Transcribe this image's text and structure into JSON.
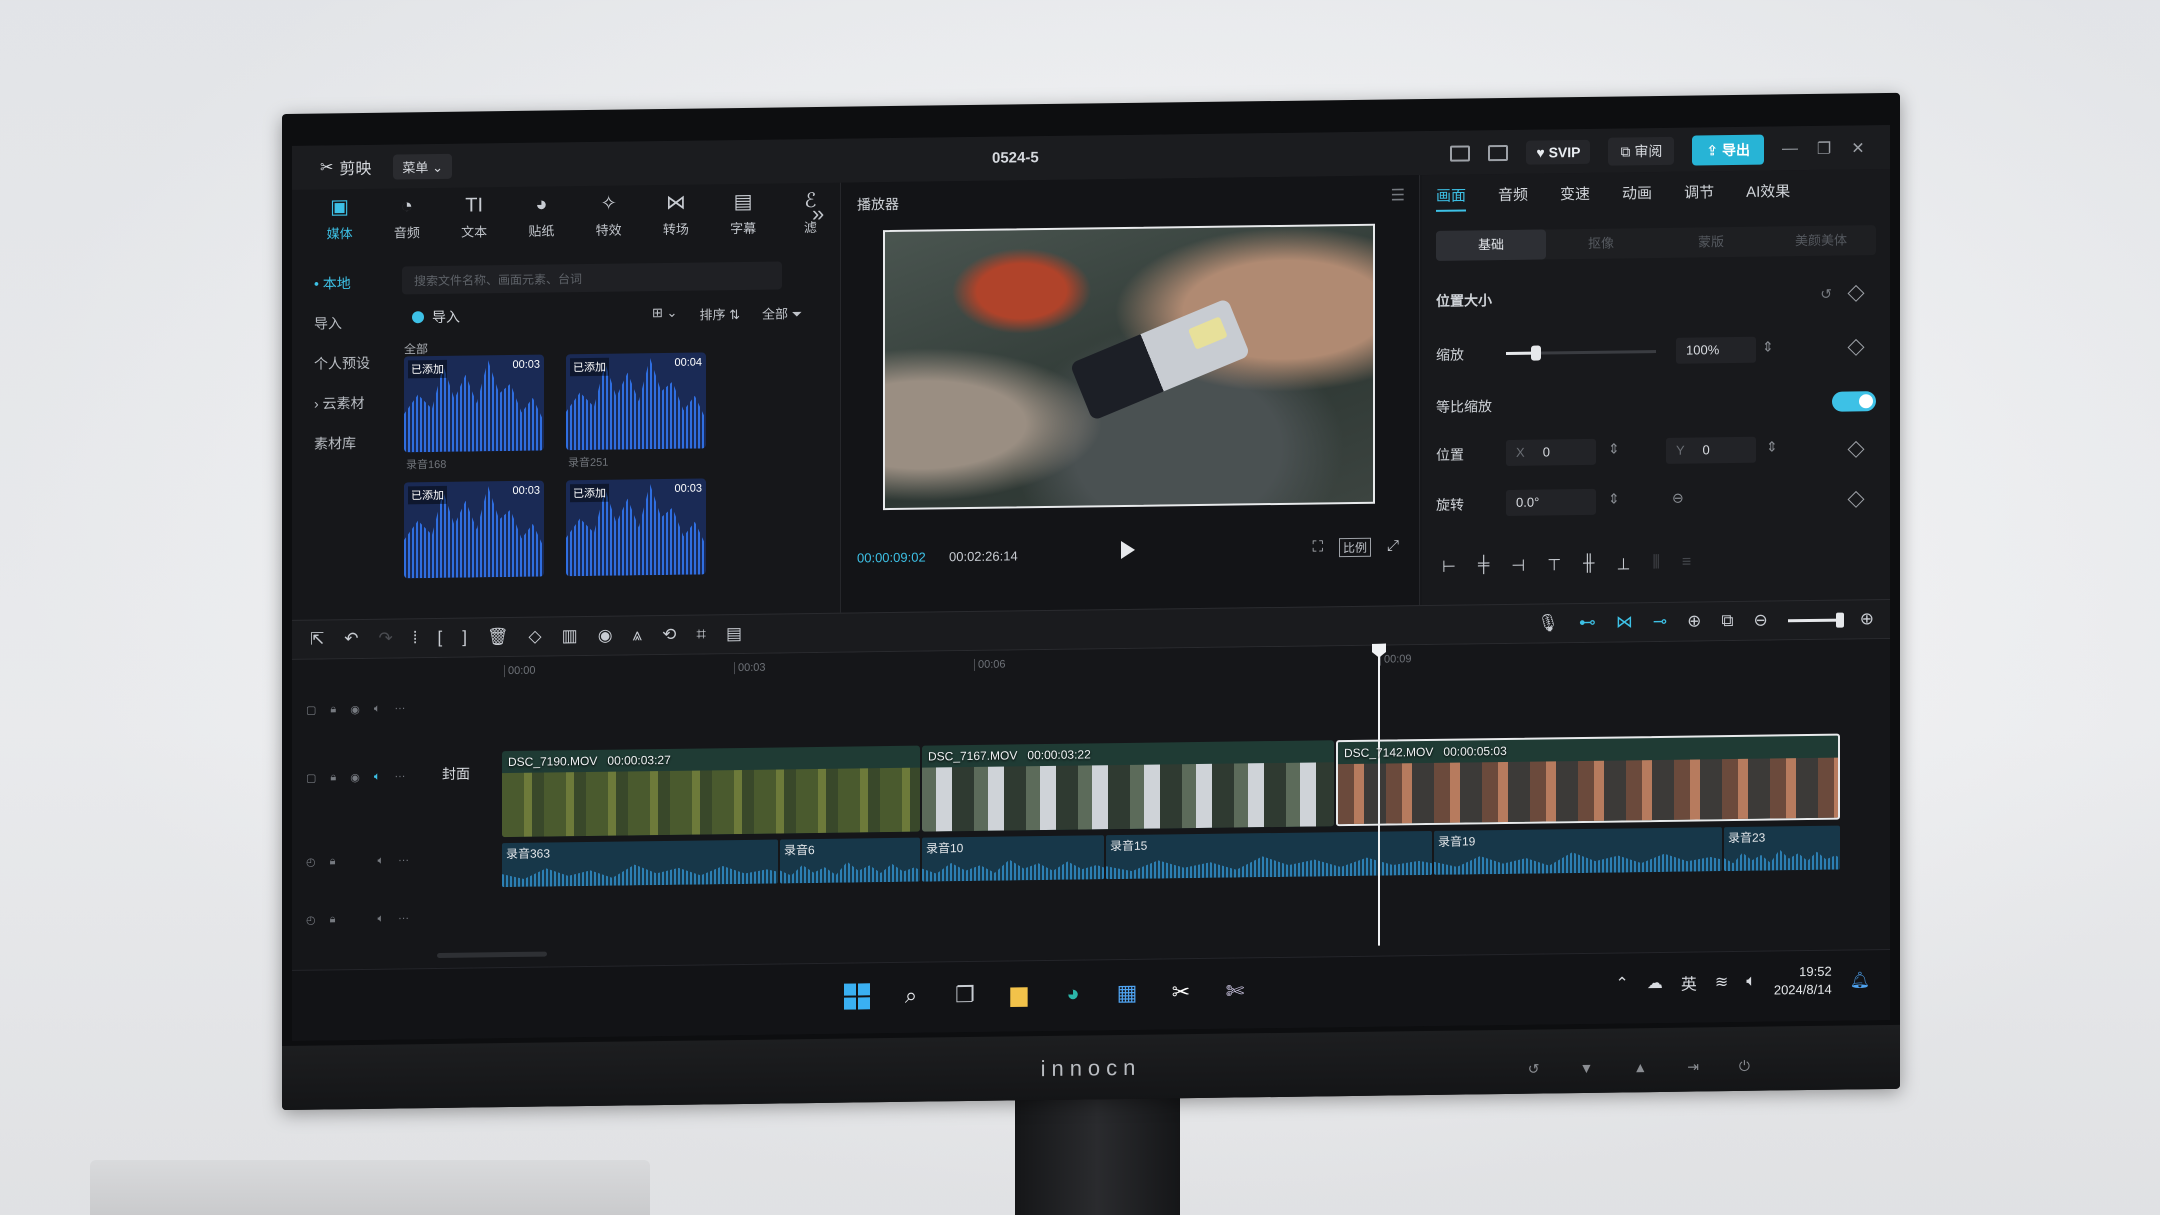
{
  "app": {
    "name": "剪映",
    "menu_label": "菜单",
    "project_title": "0524-5",
    "svip_label": "SVIP",
    "review_label": "审阅",
    "export_label": "导出"
  },
  "media_tabs": [
    {
      "label": "媒体",
      "icon": "media-icon",
      "symbol": "▣"
    },
    {
      "label": "音频",
      "icon": "audio-icon",
      "symbol": "◔"
    },
    {
      "label": "文本",
      "icon": "text-icon",
      "symbol": "TI"
    },
    {
      "label": "贴纸",
      "icon": "sticker-icon",
      "symbol": "◕"
    },
    {
      "label": "特效",
      "icon": "effects-icon",
      "symbol": "✧"
    },
    {
      "label": "转场",
      "icon": "transition-icon",
      "symbol": "⋈"
    },
    {
      "label": "字幕",
      "icon": "subtitle-icon",
      "symbol": "▤"
    },
    {
      "label": "滤",
      "icon": "filter-icon",
      "symbol": "ℰ"
    }
  ],
  "left_nav": [
    "• 本地",
    "导入",
    "个人预设",
    "› 云素材",
    "素材库"
  ],
  "search": {
    "placeholder": "搜索文件名称、画面元素、台词"
  },
  "import_row": {
    "label": "导入",
    "sort_label": "排序",
    "filter_label": "全部"
  },
  "all_label": "全部",
  "clips": [
    {
      "tag": "已添加",
      "duration": "00:03",
      "name": "录音168"
    },
    {
      "tag": "已添加",
      "duration": "00:04",
      "name": "录音251"
    },
    {
      "tag": "已添加",
      "duration": "00:03",
      "name": ""
    },
    {
      "tag": "已添加",
      "duration": "00:03",
      "name": ""
    }
  ],
  "player": {
    "title": "播放器",
    "current_time": "00:00:09:02",
    "total_time": "00:02:26:14",
    "ratio_label": "比例"
  },
  "props": {
    "tabs": [
      "画面",
      "音频",
      "变速",
      "动画",
      "调节",
      "AI效果"
    ],
    "sub_tabs": [
      "基础",
      "抠像",
      "蒙版",
      "美颜美体"
    ],
    "section_title": "位置大小",
    "scale_label": "缩放",
    "scale_value": "100%",
    "scale_fraction": 0.2,
    "uniform_scale_label": "等比缩放",
    "position_label": "位置",
    "x_label": "X",
    "x_value": "0",
    "y_label": "Y",
    "y_value": "0",
    "rotate_label": "旋转",
    "rotate_value": "0.0°"
  },
  "timeline": {
    "ruler": [
      "00:00",
      "00:03",
      "00:06",
      "00:09"
    ],
    "cover_label": "封面",
    "video_clips": [
      {
        "name": "DSC_7190.MOV",
        "duration": "00:00:03:27"
      },
      {
        "name": "DSC_7167.MOV",
        "duration": "00:00:03:22"
      },
      {
        "name": "DSC_7142.MOV",
        "duration": "00:00:05:03"
      }
    ],
    "audio_clips": [
      "录音363",
      "录音6",
      "录音10",
      "录音15",
      "录音19",
      "录音23"
    ]
  },
  "taskbar": {
    "lang": "英",
    "time": "19:52",
    "date": "2024/8/14"
  },
  "monitor": {
    "brand": "innocn"
  },
  "colors": {
    "accent": "#3dc1e6",
    "export": "#27b4d6",
    "audio_wave": "#2f6ee0"
  }
}
